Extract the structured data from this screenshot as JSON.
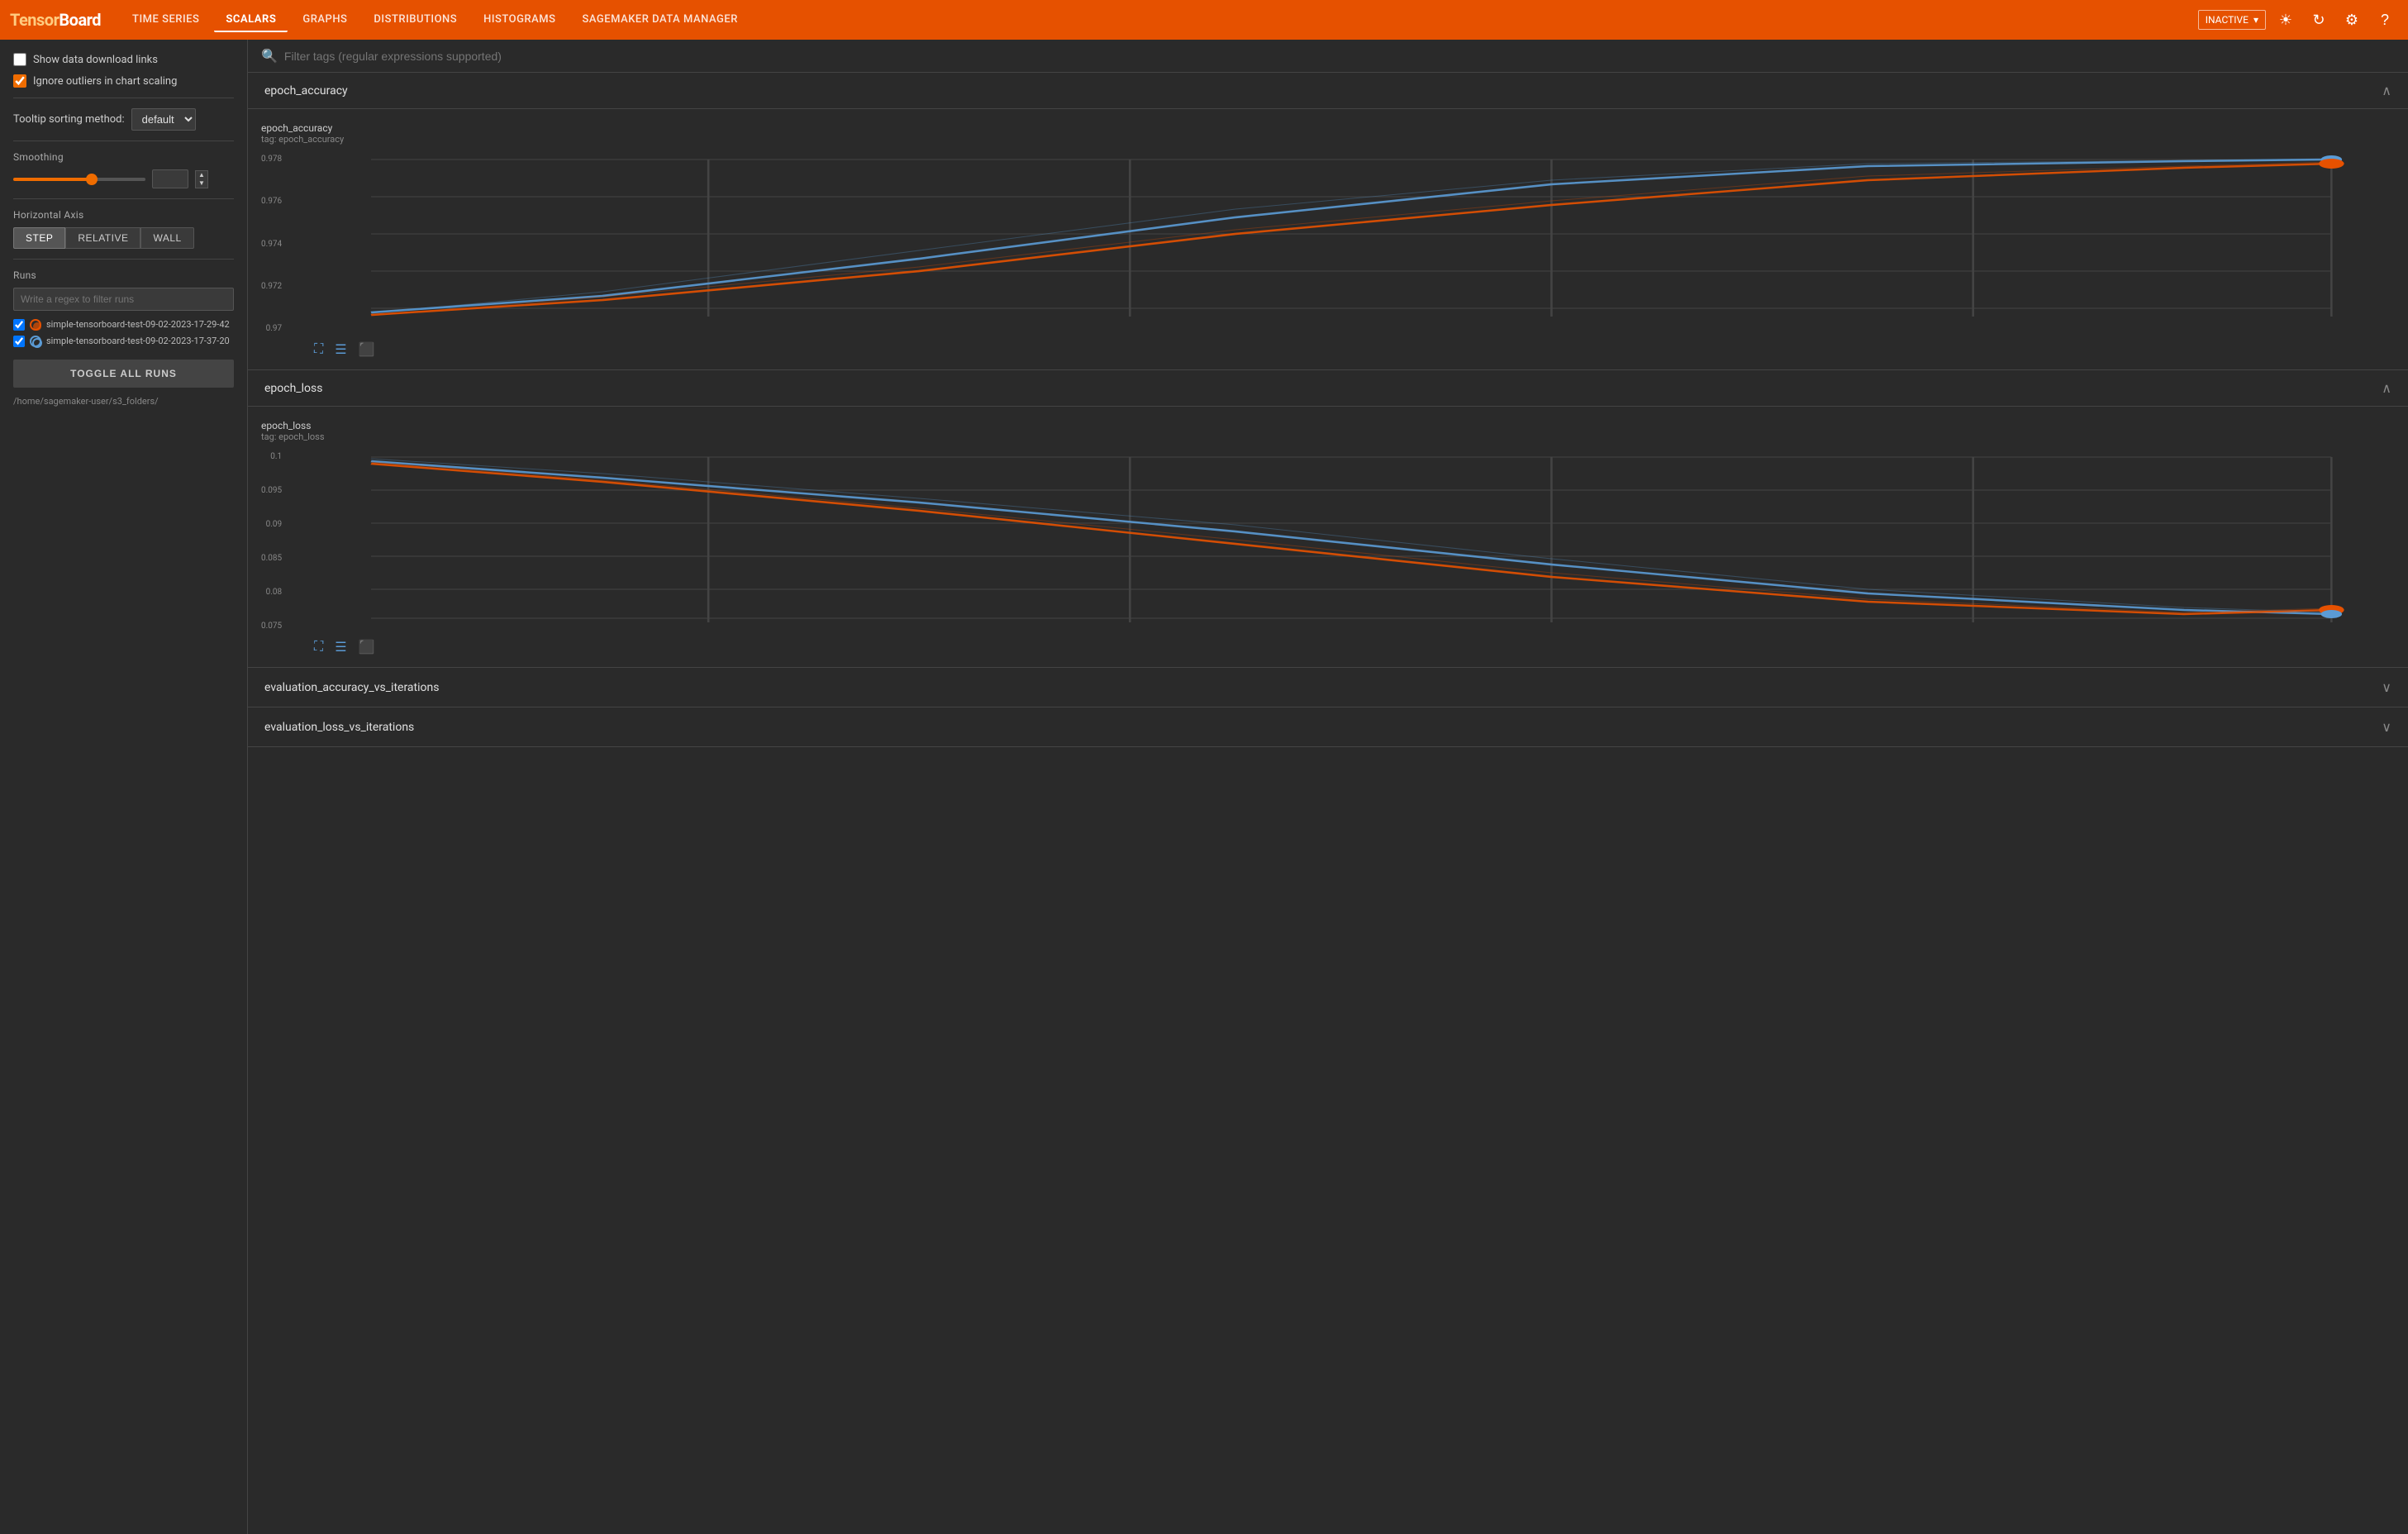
{
  "app": {
    "logo_tensor": "Tensor",
    "logo_board": "Board"
  },
  "nav": {
    "links": [
      {
        "label": "TIME SERIES",
        "active": false
      },
      {
        "label": "SCALARS",
        "active": true
      },
      {
        "label": "GRAPHS",
        "active": false
      },
      {
        "label": "DISTRIBUTIONS",
        "active": false
      },
      {
        "label": "HISTOGRAMS",
        "active": false
      },
      {
        "label": "SAGEMAKER DATA MANAGER",
        "active": false
      }
    ],
    "status": "INACTIVE",
    "icons": [
      "brightness",
      "refresh",
      "settings",
      "help"
    ]
  },
  "sidebar": {
    "show_download_label": "Show data download links",
    "ignore_outliers_label": "Ignore outliers in chart scaling",
    "tooltip_label": "Tooltip sorting method:",
    "tooltip_default": "default",
    "smoothing_label": "Smoothing",
    "smoothing_value": "0.6",
    "horizontal_axis_label": "Horizontal Axis",
    "axis_buttons": [
      "STEP",
      "RELATIVE",
      "WALL"
    ],
    "runs_label": "Runs",
    "runs_filter_placeholder": "Write a regex to filter runs",
    "runs": [
      {
        "id": "run1",
        "label": "simple-tensorboard-test-09-02-2023-17-29-42",
        "color": "#e65100",
        "checked": true,
        "dot_style": "filled"
      },
      {
        "id": "run2",
        "label": "simple-tensorboard-test-09-02-2023-17-37-20",
        "color": "#5b9bd5",
        "checked": true,
        "dot_style": "outline"
      }
    ],
    "toggle_all_label": "TOGGLE ALL RUNS",
    "folder_path": "/home/sagemaker-user/s3_folders/"
  },
  "search": {
    "placeholder": "Filter tags (regular expressions supported)"
  },
  "charts": [
    {
      "id": "epoch_accuracy",
      "title": "epoch_accuracy",
      "expanded": true,
      "chart_title": "epoch_accuracy",
      "chart_tag": "tag: epoch_accuracy",
      "y_labels": [
        "0.978",
        "0.976",
        "0.974",
        "0.972",
        "0.97"
      ],
      "actions": [
        "fullscreen",
        "data-table",
        "download"
      ]
    },
    {
      "id": "epoch_loss",
      "title": "epoch_loss",
      "expanded": true,
      "chart_title": "epoch_loss",
      "chart_tag": "tag: epoch_loss",
      "y_labels": [
        "0.1",
        "0.095",
        "0.09",
        "0.085",
        "0.08",
        "0.075"
      ],
      "actions": [
        "fullscreen",
        "data-table",
        "download"
      ]
    },
    {
      "id": "evaluation_accuracy_vs_iterations",
      "title": "evaluation_accuracy_vs_iterations",
      "expanded": false
    },
    {
      "id": "evaluation_loss_vs_iterations",
      "title": "evaluation_loss_vs_iterations",
      "expanded": false
    }
  ]
}
